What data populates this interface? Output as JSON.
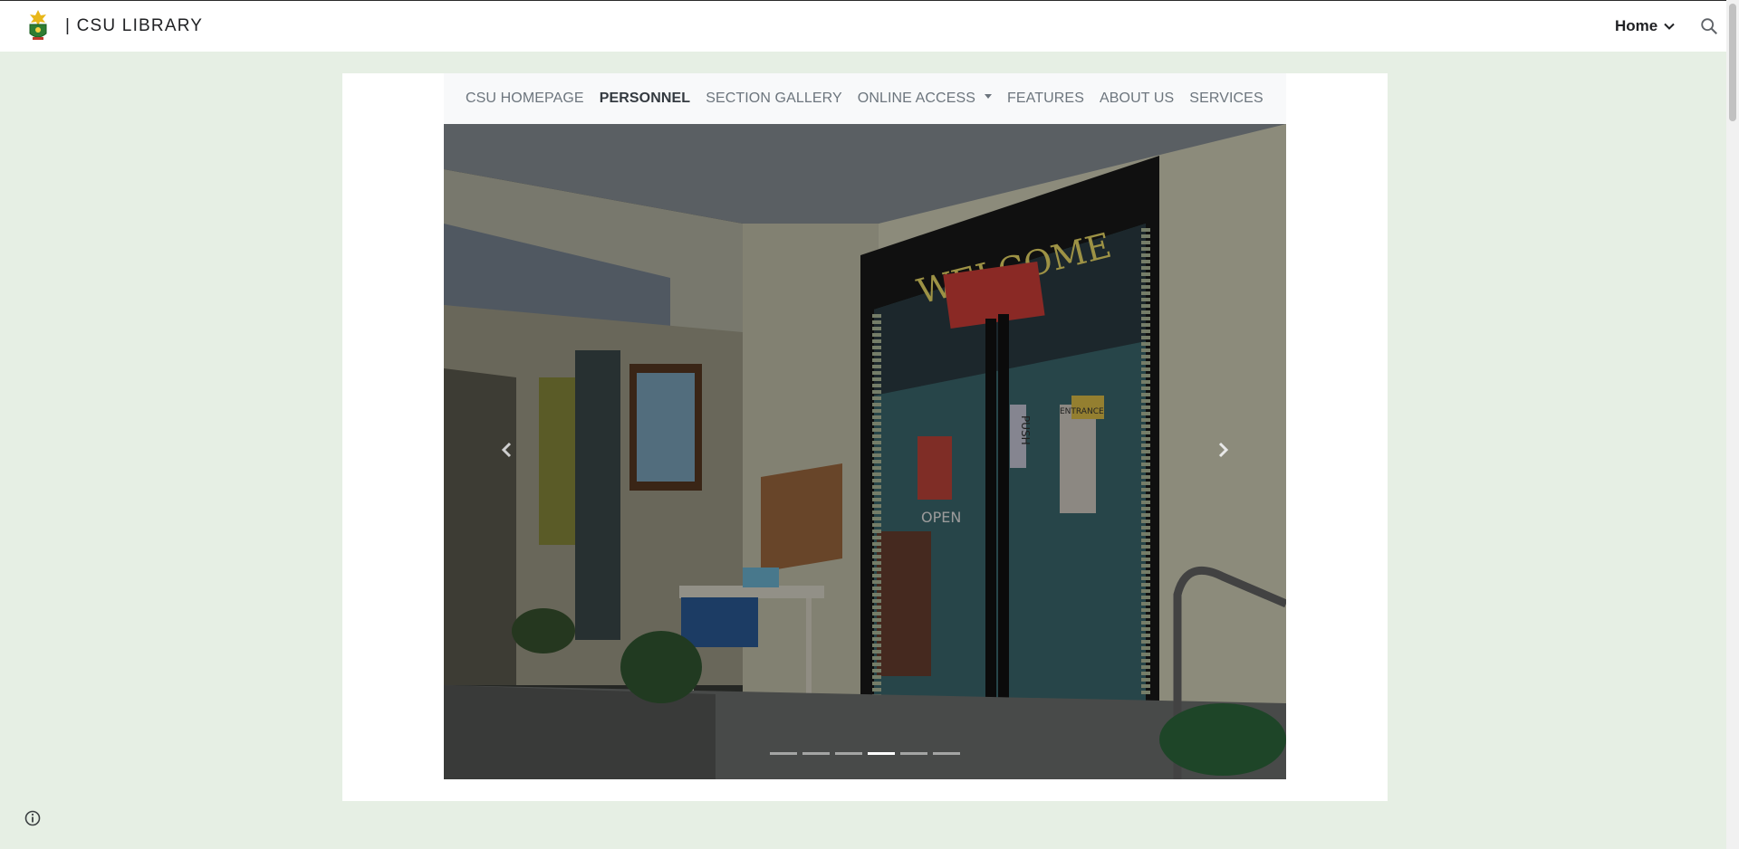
{
  "header": {
    "site_title": "| CSU LIBRARY",
    "home_label": "Home",
    "logo_icon": "csu-seal-logo",
    "search_icon": "search-icon",
    "chevron_icon": "chevron-down-icon"
  },
  "navbar": {
    "items": [
      {
        "label": "CSU HOMEPAGE",
        "active": false
      },
      {
        "label": "PERSONNEL",
        "active": true
      },
      {
        "label": "SECTION GALLERY",
        "active": false
      },
      {
        "label": "ONLINE ACCESS",
        "active": false,
        "dropdown": true
      },
      {
        "label": "FEATURES",
        "active": false
      },
      {
        "label": "ABOUT US",
        "active": false
      },
      {
        "label": "SERVICES",
        "active": false
      }
    ]
  },
  "carousel": {
    "slide_count": 6,
    "active_index": 3,
    "prev_icon": "chevron-left-icon",
    "next_icon": "chevron-right-icon",
    "scene": {
      "welcome_sign": "WELCOME",
      "door_sign_open": "OPEN",
      "door_sign_push": "PUSH",
      "entrance_sign": "ENTRANCE"
    }
  },
  "footer": {
    "info_icon": "info-icon"
  },
  "colors": {
    "page_bg": "#e6efe4",
    "navbar_bg": "#f8f9fa",
    "nav_text": "#6c757d",
    "nav_active": "#343a40"
  }
}
